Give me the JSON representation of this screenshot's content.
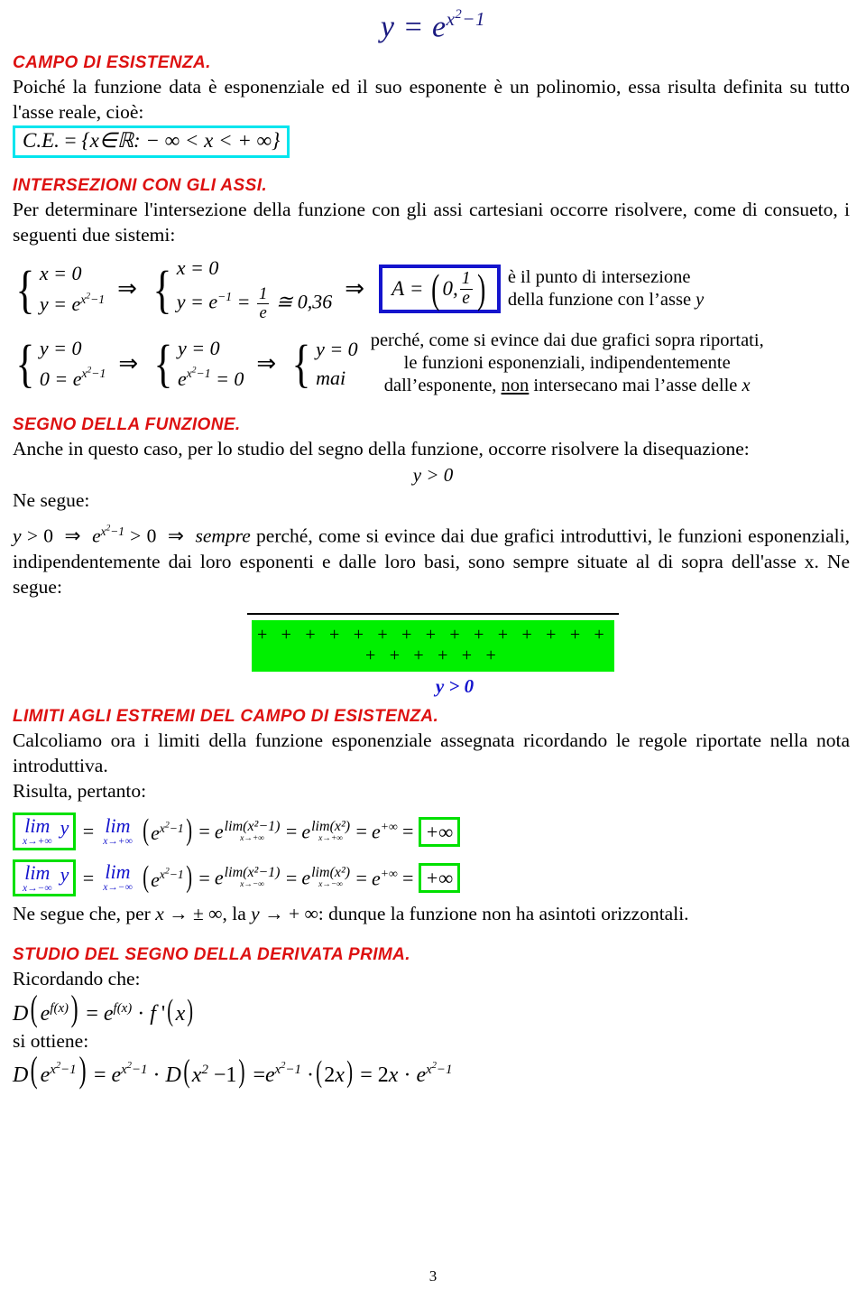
{
  "document": {
    "page_number": "3",
    "title_formula": "y = e^(x²−1)"
  },
  "colors": {
    "heading_red": "#dd1111",
    "title_navy": "#1a1a80",
    "ce_box_cyan": "#00e5ee",
    "a_box_blue": "#1414cd",
    "sign_green": "#00f000",
    "limit_box_green": "#00e000"
  },
  "sections": {
    "campo": {
      "heading": "CAMPO DI ESISTENZA.",
      "p1": "Poiché la funzione data è esponenziale ed il suo esponente è un polinomio, essa risulta definita su tutto l'asse reale, cioè:",
      "ce_formula": "C.E. = {x∈ℝ: − ∞ < x < + ∞}"
    },
    "intersezioni": {
      "heading": "INTERSEZIONI CON GLI ASSI.",
      "p1": "Per determinare l'intersezione della funzione con gli assi cartesiani occorre risolvere, come di consueto, i seguenti due sistemi:",
      "system1": {
        "left": [
          "x = 0",
          "y = e^(x²−1)"
        ],
        "mid": [
          "x = 0",
          "y = e^(−1) = 1/e ≅ 0,36"
        ],
        "result": "A = (0, 1/e)",
        "note_line1": "è il punto di  intersezione",
        "note_line2": "della funzione con l'asse y"
      },
      "system2": {
        "left": [
          "y = 0",
          "0 = e^(x²−1)"
        ],
        "mid": [
          "y = 0",
          "e^(x²−1) = 0"
        ],
        "right": [
          "y = 0",
          "mai"
        ],
        "note_line1": "perché, come si evince dai due grafici sopra riportati,",
        "note_line2": "le funzioni esponenziali, indipendentemente",
        "note_line3_pre": "dall'esponente, ",
        "note_line3_underlined": "non",
        "note_line3_post": " intersecano mai l'asse delle x"
      }
    },
    "segno": {
      "heading": "SEGNO DELLA FUNZIONE.",
      "p1": "Anche in questo caso, per lo studio del segno della funzione, occorre risolvere la disequazione:",
      "disequazione": "y > 0",
      "ne_segue": "Ne segue:",
      "p2_pre": "y > 0  ⇒  e^(x²−1) > 0  ⇒  ",
      "p2_italic": "sempre",
      "p2_post": " perché, come si evince dai due grafici introduttivi, le funzioni esponenziali, indipendentemente dai loro esponenti e dalle loro basi, sono sempre situate al di sopra dell'asse x. Ne segue:",
      "sign_bar_symbols": "+ + + + + + + + + + + + + + + + + + + + +",
      "sign_bar_label": "y > 0"
    },
    "limiti": {
      "heading": "LIMITI AGLI ESTREMI DEL CAMPO DI ESISTENZA.",
      "p1": "Calcoliamo ora i limiti della funzione esponenziale assegnata ricordando le regole riportate nella nota introduttiva.",
      "p2": "Risulta, pertanto:",
      "limit1": {
        "lhs_op": "lim",
        "lhs_sub": "x→+∞",
        "lhs_var": "y",
        "step2_op": "lim",
        "step2_sub": "x→+∞",
        "step2_expr": "e^(x²−1)",
        "step3_exp_op": "lim",
        "step3_exp_sub": "x→+∞",
        "step3_exp_arg": "(x²−1)",
        "step4_exp_op": "lim",
        "step4_exp_sub": "x→+∞",
        "step4_exp_arg": "(x²)",
        "step5": "e^(+∞)",
        "result": "+∞"
      },
      "limit2": {
        "lhs_op": "lim",
        "lhs_sub": "x→−∞",
        "lhs_var": "y",
        "step2_op": "lim",
        "step2_sub": "x→−∞",
        "step2_expr": "e^(x²−1)",
        "step3_exp_op": "lim",
        "step3_exp_sub": "x→−∞",
        "step3_exp_arg": "(x²−1)",
        "step4_exp_op": "lim",
        "step4_exp_sub": "x→−∞",
        "step4_exp_arg": "(x²)",
        "step5": "e^(+∞)",
        "result": "+∞"
      },
      "conclusion": "Ne segue che, per x → ± ∞, la y → + ∞: dunque la funzione non ha asintoti orizzontali."
    },
    "derivata": {
      "heading": "STUDIO DEL SEGNO DELLA DERIVATA PRIMA.",
      "p1": "Ricordando che:",
      "rule": "D(e^f(x)) = e^f(x) · f'(x)",
      "p2": "si ottiene:",
      "computation": "D(e^(x²−1)) = e^(x²−1) · D(x²−1) = e^(x²−1) · (2x) = 2x · e^(x²−1)"
    }
  }
}
